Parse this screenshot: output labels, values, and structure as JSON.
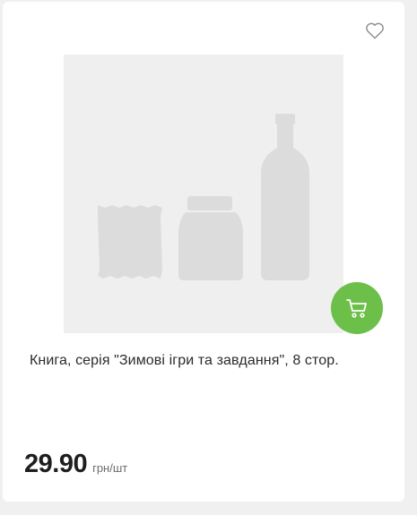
{
  "product": {
    "title": "Книга, серія \"Зимові ігри та завдання\", 8 стор.",
    "price": "29.90",
    "unit": "грн/шт",
    "image_placeholder": "product-placeholder-image",
    "wishlist_icon": "heart-outline-icon",
    "cart_icon": "shopping-cart-icon"
  },
  "colors": {
    "cart_button": "#6cc04a",
    "placeholder_bg": "#efefef",
    "placeholder_shapes": "#dcdcdc"
  }
}
